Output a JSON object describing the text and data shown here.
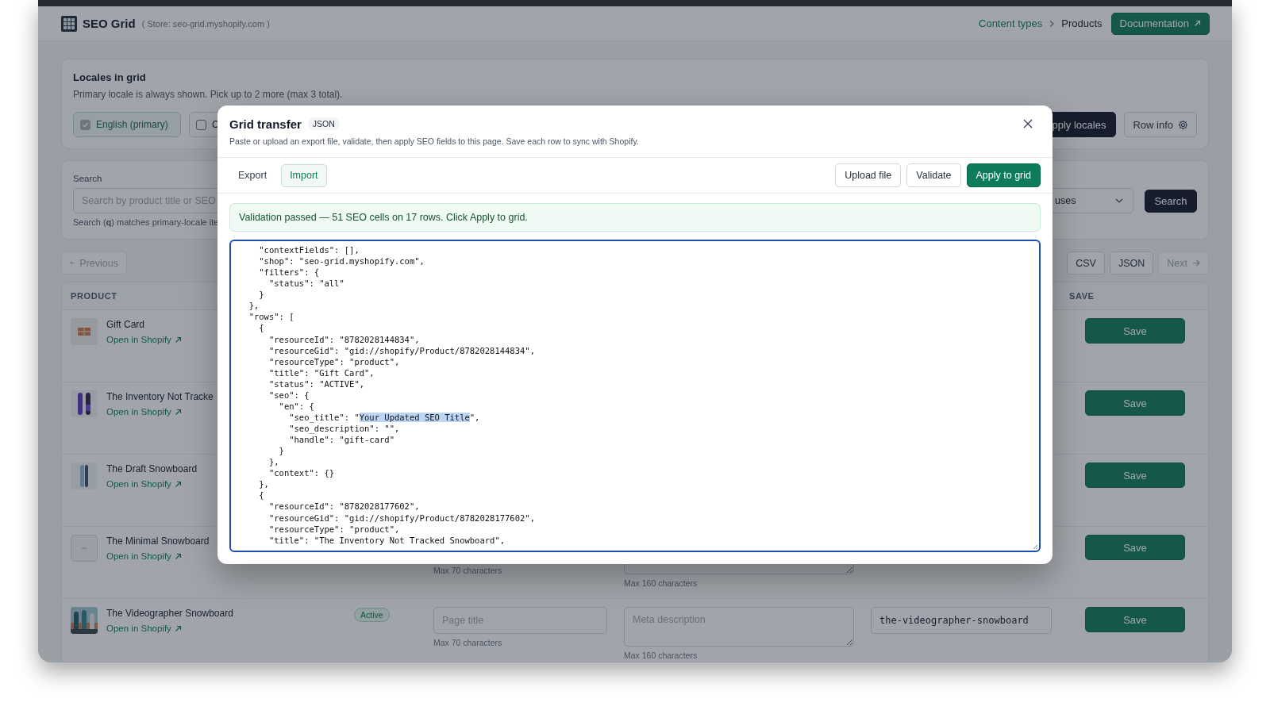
{
  "app_header": {
    "title": "SEO Grid",
    "store": "( Store: seo-grid.myshopify.com )",
    "breadcrumbs": [
      {
        "label": "Content types",
        "kind": "link"
      },
      {
        "label": "Products",
        "kind": "current"
      }
    ],
    "doc_button": "Documentation"
  },
  "locales": {
    "title": "Locales in grid",
    "hint": "Primary locale is always shown. Pick up to 2 more (max 3 total).",
    "options": [
      {
        "label": "English (primary)",
        "checked": true,
        "disabled": true
      },
      {
        "label": "C",
        "checked": false,
        "disabled": false
      }
    ],
    "apply_button": "pply locales",
    "row_info_button": "Row info"
  },
  "search": {
    "label": "Search",
    "placeholder": "Search by product title or SEO",
    "help": "Search (**q**) matches primary-locale ite",
    "status_select": "uses",
    "button": "Search"
  },
  "pagination": {
    "previous": {
      "label": "Previous",
      "disabled": true
    },
    "exports": [
      "CSV",
      "JSON"
    ],
    "next": {
      "label": "Next",
      "disabled": true
    }
  },
  "table": {
    "columns": [
      {
        "label": "PRODUCT",
        "kind": "product"
      },
      {
        "label": "SAVE",
        "kind": "save"
      }
    ],
    "rows": [
      {
        "title": "Gift Card",
        "link": "Open in Shopify",
        "save": "Save"
      },
      {
        "title": "The Inventory Not Tracke",
        "link": "Open in Shopify",
        "save": "Save"
      },
      {
        "title": "The Draft Snowboard",
        "link": "Open in Shopify",
        "save": "Save"
      },
      {
        "title": "The Minimal Snowboard",
        "link": "Open in Shopify",
        "save": "Save",
        "title_field": {
          "hint": "Max 70 characters"
        },
        "description_field": {
          "hint": "Max 160 characters"
        }
      },
      {
        "title": "The Videographer Snowboard",
        "link": "Open in Shopify",
        "status": "Active",
        "title_field": {
          "placeholder": "Page title",
          "hint": "Max 70 characters"
        },
        "description_field": {
          "placeholder": "Meta description",
          "hint": "Max 160 characters"
        },
        "handle": "the-videographer-snowboard",
        "save": "Save"
      }
    ]
  },
  "modal": {
    "title": "Grid transfer",
    "format_badge": "JSON",
    "subtitle": "Paste or upload an export file, validate, then apply SEO fields to this page. Save each row to sync with Shopify.",
    "tabs": [
      {
        "label": "Export",
        "selected": false
      },
      {
        "label": "Import",
        "selected": true
      }
    ],
    "actions": [
      {
        "label": "Upload file",
        "kind": "secondary"
      },
      {
        "label": "Validate",
        "kind": "secondary"
      },
      {
        "label": "Apply to grid",
        "kind": "primary"
      }
    ],
    "alert": {
      "text": "Validation passed — 51 SEO cells on 17 rows. Click Apply to grid.",
      "kind": "success"
    },
    "editor": {
      "before": "    \"contextFields\": [],\n    \"shop\": \"seo-grid.myshopify.com\",\n    \"filters\": {\n      \"status\": \"all\"\n    }\n  },\n  \"rows\": [\n    {\n      \"resourceId\": \"8782028144834\",\n      \"resourceGid\": \"gid://shopify/Product/8782028144834\",\n      \"resourceType\": \"product\",\n      \"title\": \"Gift Card\",\n      \"status\": \"ACTIVE\",\n      \"seo\": {\n        \"en\": {\n          \"seo_title\": \"",
      "selection": "Your Updated SEO Title",
      "after": "\",\n          \"seo_description\": \"\",\n          \"handle\": \"gift-card\"\n        }\n      },\n      \"context\": {}\n    },\n    {\n      \"resourceId\": \"8782028177602\",\n      \"resourceGid\": \"gid://shopify/Product/8782028177602\",\n      \"resourceType\": \"product\",\n      \"title\": \"The Inventory Not Tracked Snowboard\","
    }
  }
}
